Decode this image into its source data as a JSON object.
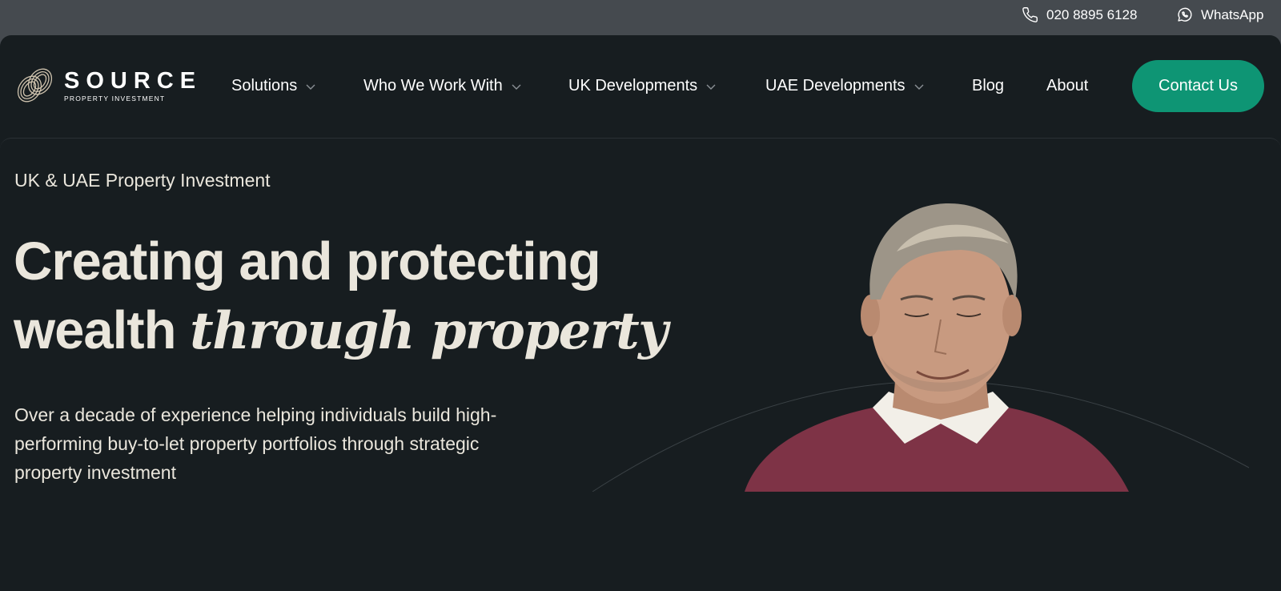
{
  "topbar": {
    "phone_icon": "phone-icon",
    "phone": "020 8895 6128",
    "whatsapp_icon": "whatsapp-icon",
    "whatsapp": "WhatsApp"
  },
  "header": {
    "logo": {
      "word": "SOURCE",
      "sub": "PROPERTY INVESTMENT"
    },
    "nav": [
      {
        "label": "Solutions",
        "has_dropdown": true
      },
      {
        "label": "Who We Work With",
        "has_dropdown": true
      },
      {
        "label": "UK Developments",
        "has_dropdown": true
      },
      {
        "label": "UAE Developments",
        "has_dropdown": true
      },
      {
        "label": "Blog",
        "has_dropdown": false
      },
      {
        "label": "About",
        "has_dropdown": false
      }
    ],
    "cta": "Contact Us"
  },
  "hero": {
    "eyebrow": "UK & UAE Property Investment",
    "headline_line1": "Creating and protecting",
    "headline_line2_plain": "wealth",
    "headline_line2_italic": "through property",
    "lead": "Over a decade of experience helping individuals build high-performing buy-to-let property portfolios through strategic property investment"
  },
  "colors": {
    "background": "#171d20",
    "topbar": "#454a4f",
    "accent": "#0e9574",
    "text": "#eae6dc"
  }
}
